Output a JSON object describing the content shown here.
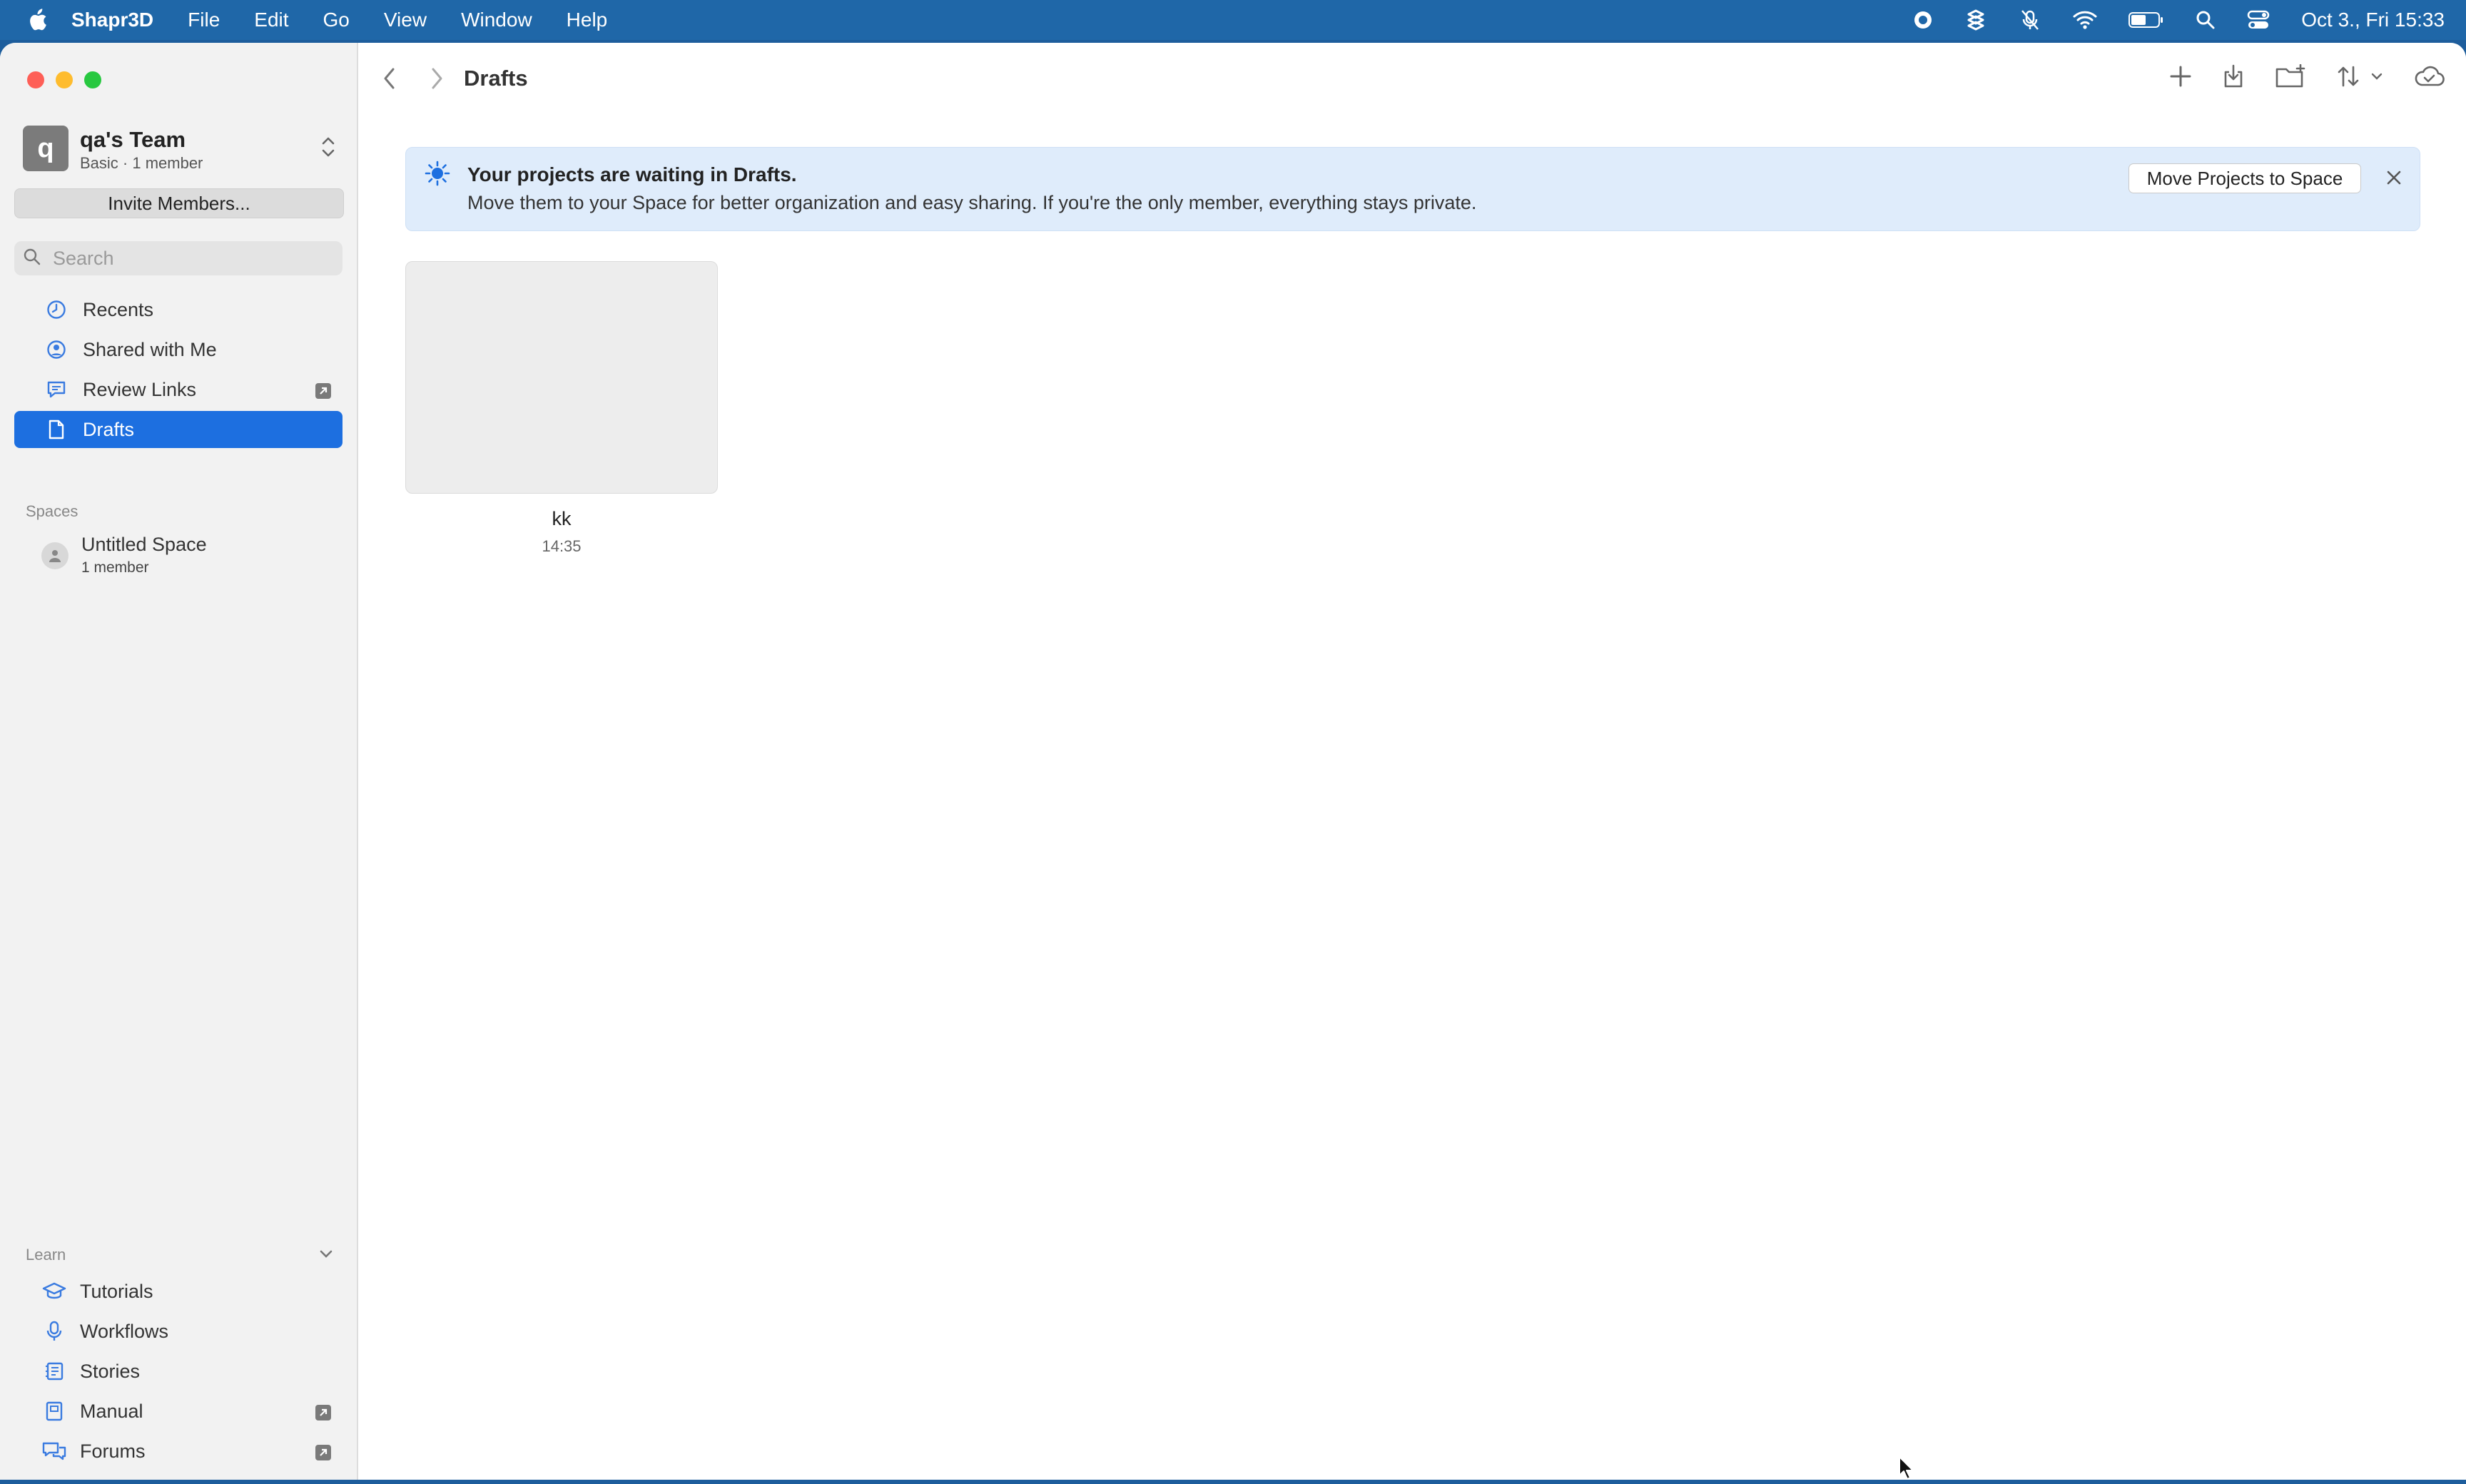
{
  "menubar": {
    "app": "Shapr3D",
    "items": [
      "File",
      "Edit",
      "Go",
      "View",
      "Window",
      "Help"
    ],
    "clock": "Oct 3., Fri  15:33"
  },
  "sidebar": {
    "team": {
      "initial": "q",
      "name": "qa's Team",
      "plan": "Basic · 1 member"
    },
    "invite_label": "Invite Members...",
    "search_placeholder": "Search",
    "nav": [
      {
        "label": "Recents",
        "icon": "clock-icon"
      },
      {
        "label": "Shared with Me",
        "icon": "person-circle-icon"
      },
      {
        "label": "Review Links",
        "icon": "chat-bubble-icon",
        "external": true
      },
      {
        "label": "Drafts",
        "icon": "document-icon",
        "active": true
      }
    ],
    "spaces_label": "Spaces",
    "spaces": [
      {
        "name": "Untitled Space",
        "meta": "1 member"
      }
    ],
    "learn_label": "Learn",
    "learn": [
      {
        "label": "Tutorials",
        "icon": "graduation-cap-icon"
      },
      {
        "label": "Workflows",
        "icon": "microphone-icon"
      },
      {
        "label": "Stories",
        "icon": "stories-icon"
      },
      {
        "label": "Manual",
        "icon": "book-icon",
        "external": true
      },
      {
        "label": "Forums",
        "icon": "forum-icon",
        "external": true
      }
    ]
  },
  "main": {
    "title": "Drafts",
    "banner": {
      "heading": "Your projects are waiting in Drafts.",
      "body": "Move them to your Space for better organization and easy sharing. If you're the only member, everything stays private.",
      "button": "Move Projects to Space"
    },
    "projects": [
      {
        "name": "kk",
        "time": "14:35"
      }
    ]
  },
  "colors": {
    "accent": "#1d6fe0",
    "banner_bg": "#dfecfb",
    "menubar_bg": "#1f67a8"
  }
}
